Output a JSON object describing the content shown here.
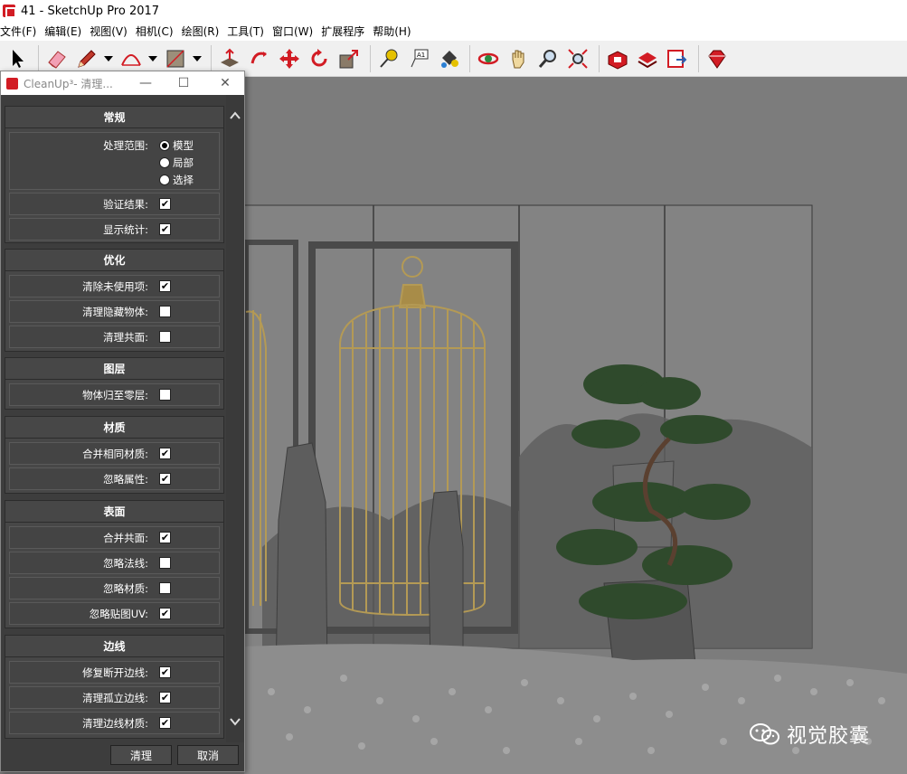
{
  "window": {
    "title": "41 - SketchUp Pro 2017"
  },
  "menu": [
    "文件(F)",
    "编辑(E)",
    "视图(V)",
    "相机(C)",
    "绘图(R)",
    "工具(T)",
    "窗口(W)",
    "扩展程序",
    "帮助(H)"
  ],
  "toolbar": {
    "tools": [
      "select-tool",
      "eraser-tool",
      "pencil-tool",
      "arc-tool",
      "rectangle-tool",
      "push-pull-tool",
      "follow-me-tool",
      "move-tool",
      "rotate-tool",
      "scale-tool",
      "tape-measure-tool",
      "text-tool",
      "paint-bucket-tool",
      "orbit-tool",
      "pan-tool",
      "zoom-tool",
      "zoom-extents-tool",
      "3d-warehouse-tool",
      "extension-warehouse-tool",
      "send-to-layout-tool",
      "extension-manager-tool"
    ]
  },
  "dialog": {
    "title": "CleanUp³- 清理...",
    "sections": {
      "general": {
        "header": "常规",
        "scope_label": "处理范围:",
        "scope_options": [
          "模型",
          "局部",
          "选择"
        ],
        "scope_selected": "模型",
        "validate_label": "验证结果:",
        "validate_checked": true,
        "stats_label": "显示统计:",
        "stats_checked": true
      },
      "optimize": {
        "header": "优化",
        "purge_label": "清除未使用项:",
        "purge_checked": true,
        "hidden_label": "清理隐藏物体:",
        "hidden_checked": false,
        "coplanar_label": "清理共面:",
        "coplanar_checked": false
      },
      "layers": {
        "header": "图层",
        "layer0_label": "物体归至零层:",
        "layer0_checked": false
      },
      "materials": {
        "header": "材质",
        "merge_label": "合并相同材质:",
        "merge_checked": true,
        "ignore_attr_label": "忽略属性:",
        "ignore_attr_checked": true
      },
      "faces": {
        "header": "表面",
        "merge_coplanar_label": "合并共面:",
        "merge_coplanar_checked": true,
        "ignore_normals_label": "忽略法线:",
        "ignore_normals_checked": false,
        "ignore_material_label": "忽略材质:",
        "ignore_material_checked": false,
        "ignore_uv_label": "忽略贴图UV:",
        "ignore_uv_checked": true
      },
      "edges": {
        "header": "边线",
        "repair_label": "修复断开边线:",
        "repair_checked": true,
        "stray_label": "清理孤立边线:",
        "stray_checked": true,
        "edge_material_label": "清理边线材质:",
        "edge_material_checked": true
      }
    },
    "buttons": {
      "ok": "清理",
      "cancel": "取消"
    }
  },
  "watermark": {
    "text": "视觉胶囊"
  },
  "colors": {
    "dialog_bg": "#3d3d3d",
    "section_bg": "#474747",
    "viewport_bg": "#7c7c7c",
    "accent_red": "#d21c24"
  }
}
